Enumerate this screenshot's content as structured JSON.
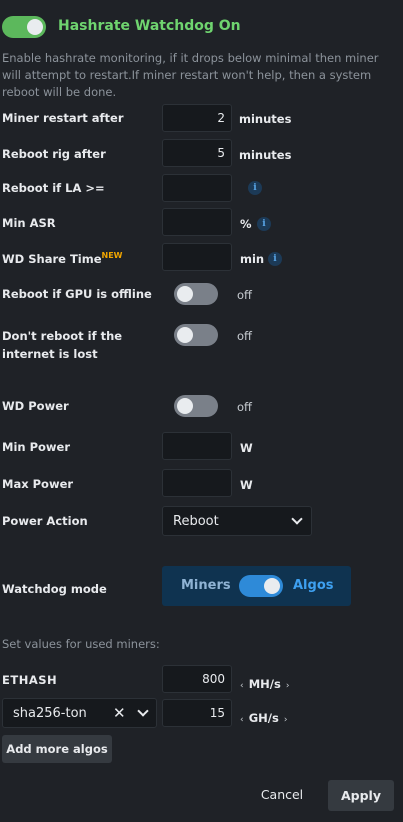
{
  "header": {
    "title": "Hashrate Watchdog On",
    "enabled": true,
    "description": "Enable hashrate monitoring, if it drops below minimal then miner will attempt to restart.If miner restart won't help, then a system reboot will be done."
  },
  "settings": {
    "miner_restart": {
      "label": "Miner restart after",
      "value": "2",
      "unit": "minutes"
    },
    "reboot_rig": {
      "label": "Reboot rig after",
      "value": "5",
      "unit": "minutes"
    },
    "reboot_la": {
      "label": "Reboot if LA >=",
      "value": "",
      "info": "i"
    },
    "min_asr": {
      "label": "Min ASR",
      "value": "",
      "unit": "%",
      "info": "i"
    },
    "wd_share_time": {
      "label": "WD Share Time",
      "badge": "NEW",
      "value": "",
      "unit": "min",
      "info": "i"
    },
    "reboot_gpu_offline": {
      "label": "Reboot if GPU is offline",
      "state": "off"
    },
    "no_reboot_internet": {
      "label": "Don't reboot if the internet is lost",
      "state": "off"
    },
    "wd_power": {
      "label": "WD Power",
      "state": "off"
    },
    "min_power": {
      "label": "Min Power",
      "value": "",
      "unit": "W"
    },
    "max_power": {
      "label": "Max Power",
      "value": "",
      "unit": "W"
    },
    "power_action": {
      "label": "Power Action",
      "selected": "Reboot"
    }
  },
  "watchdog_mode": {
    "label": "Watchdog mode",
    "left_option": "Miners",
    "right_option": "Algos",
    "selected": "Algos"
  },
  "algos": {
    "hint": "Set values for used miners:",
    "rows": [
      {
        "name": "ETHASH",
        "value": "800",
        "unit": "MH/s"
      },
      {
        "name": "sha256-ton",
        "value": "15",
        "unit": "GH/s"
      }
    ],
    "add_label": "Add more algos",
    "arrow_left": "‹",
    "arrow_right": "›",
    "clear_symbol": "✕"
  },
  "footer": {
    "cancel_label": "Cancel",
    "apply_label": "Apply"
  },
  "colors": {
    "background": "#1f2227",
    "accent_green": "#5cb85c",
    "accent_blue": "#2e8ad8",
    "badge_orange": "#f0a500"
  }
}
